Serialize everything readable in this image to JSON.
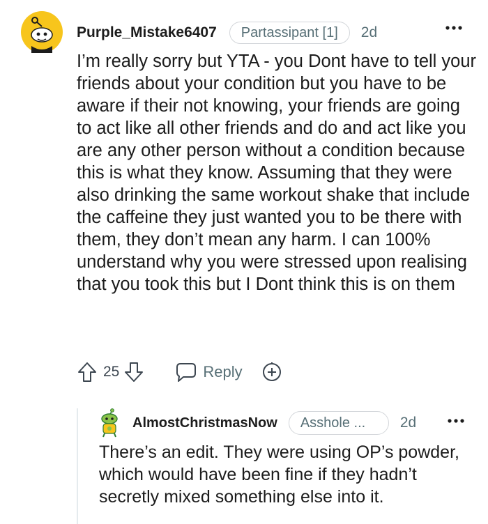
{
  "comment": {
    "username": "Purple_Mistake6407",
    "flair": "Partassipant [1]",
    "time": "2d",
    "body": "I’m really sorry but YTA - you Dont have to tell your friends about your condition but you have to be aware if their not knowing, your friends are going to act like all other friends and do and act like you are any other person without a condition because this is what they know. Assuming that they were also drinking the same workout shake that include the caffeine they just wanted you to be there with them, they don’t mean any harm. I can 100% understand why you were stressed upon realising that you took this but I Dont think this is on them",
    "score": "25",
    "reply_label": "Reply",
    "avatar_icon": "snoo-avatar-icon"
  },
  "reply": {
    "username": "AlmostChristmasNow",
    "flair": "Asshole ...",
    "time": "2d",
    "body": "There’s an edit. They were using OP’s powder, which would have been fine if they hadn’t secretly mixed something else into it.",
    "avatar_icon": "green-snoo-avatar-icon"
  },
  "colors": {
    "avatar_yellow": "#f7c51c",
    "meta_gray": "#576f76",
    "border_gray": "#d3d6da"
  }
}
